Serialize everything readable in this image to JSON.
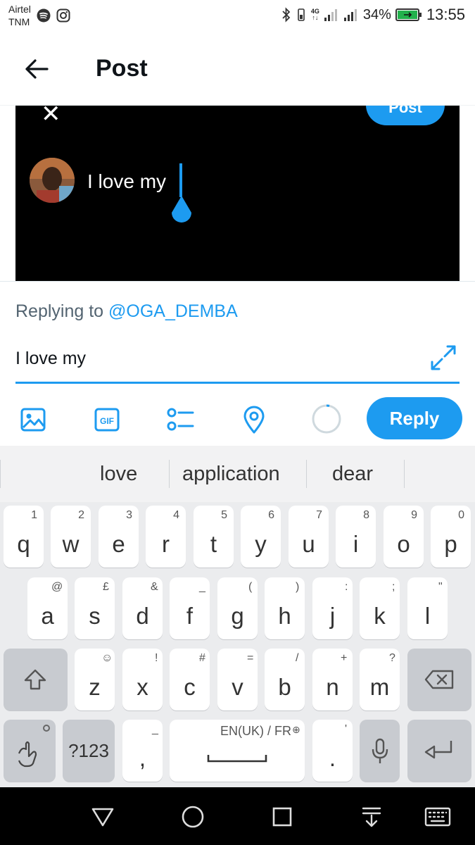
{
  "status_bar": {
    "carrier_line1": "Airtel",
    "carrier_line2": "TNM",
    "network": "4G",
    "battery_percent": "34%",
    "time": "13:55"
  },
  "header": {
    "title": "Post"
  },
  "quoted_image": {
    "post_button_label": "Post",
    "text": "I love my"
  },
  "reply": {
    "prefix": "Replying to ",
    "handle": "@OGA_DEMBA",
    "input_value": "I love my"
  },
  "toolbar": {
    "gif_label": "GIF",
    "reply_label": "Reply",
    "accent_color": "#1d9bf0"
  },
  "keyboard": {
    "suggestions": [
      "love",
      "application",
      "dear"
    ],
    "row1": [
      {
        "key": "q",
        "hint": "1"
      },
      {
        "key": "w",
        "hint": "2"
      },
      {
        "key": "e",
        "hint": "3"
      },
      {
        "key": "r",
        "hint": "4"
      },
      {
        "key": "t",
        "hint": "5"
      },
      {
        "key": "y",
        "hint": "6"
      },
      {
        "key": "u",
        "hint": "7"
      },
      {
        "key": "i",
        "hint": "8"
      },
      {
        "key": "o",
        "hint": "9"
      },
      {
        "key": "p",
        "hint": "0"
      }
    ],
    "row2": [
      {
        "key": "a",
        "hint": "@"
      },
      {
        "key": "s",
        "hint": "£"
      },
      {
        "key": "d",
        "hint": "&"
      },
      {
        "key": "f",
        "hint": "_"
      },
      {
        "key": "g",
        "hint": "("
      },
      {
        "key": "h",
        "hint": ")"
      },
      {
        "key": "j",
        "hint": ":"
      },
      {
        "key": "k",
        "hint": ";"
      },
      {
        "key": "l",
        "hint": "\""
      }
    ],
    "row3": [
      {
        "key": "z",
        "hint": "☺"
      },
      {
        "key": "x",
        "hint": "!"
      },
      {
        "key": "c",
        "hint": "#"
      },
      {
        "key": "v",
        "hint": "="
      },
      {
        "key": "b",
        "hint": "/"
      },
      {
        "key": "n",
        "hint": "+"
      },
      {
        "key": "m",
        "hint": "?"
      }
    ],
    "symbols_label": "?123",
    "comma_key": ",",
    "comma_hint": "_",
    "space_label": "EN(UK) / FR",
    "period_key": ".",
    "period_hint": "'"
  }
}
